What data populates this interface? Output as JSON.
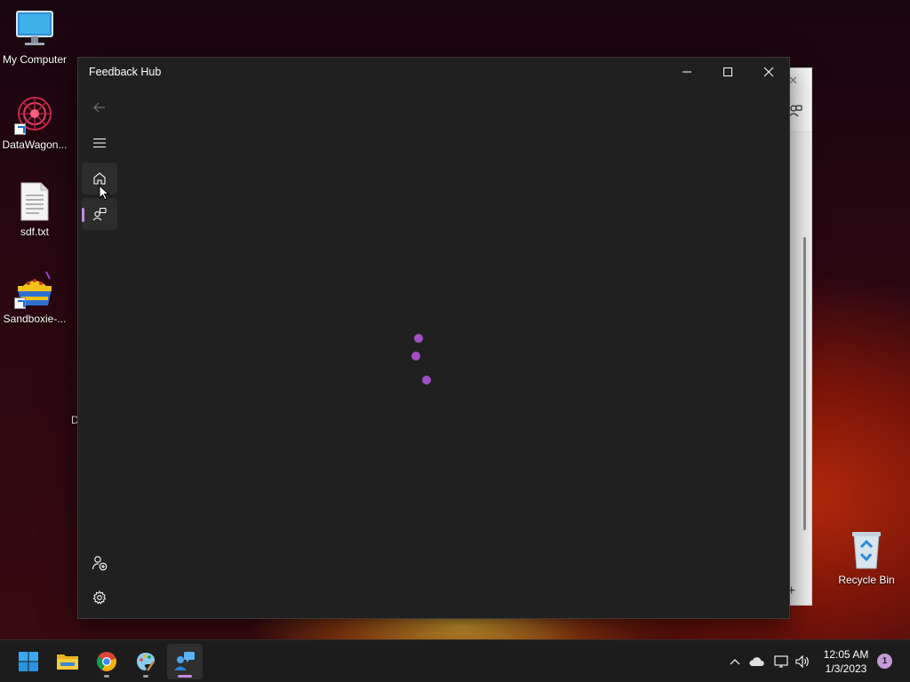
{
  "desktop": {
    "icons": [
      {
        "label": "My Computer",
        "icon": "monitor-icon"
      },
      {
        "label": "DataWagon...",
        "icon": "datawagon-icon"
      },
      {
        "label": "sdf.txt",
        "icon": "text-file-icon"
      },
      {
        "label": "Sandboxie-...",
        "icon": "sandboxie-icon"
      },
      {
        "label": "Recycle Bin",
        "icon": "recycle-bin-icon"
      }
    ],
    "stray_text": "D"
  },
  "window": {
    "title": "Feedback Hub",
    "accent": "#c28ae0",
    "loading_color": "#a14fc2",
    "nav": {
      "back": "back-arrow-icon",
      "menu": "hamburger-menu-icon",
      "home": "home-icon",
      "feedback": "feedback-icon",
      "add_account": "add-account-icon",
      "settings": "gear-icon"
    }
  },
  "taskbar": {
    "apps": [
      "start-button",
      "file-explorer",
      "chrome",
      "paint",
      "feedback-hub"
    ],
    "clock": {
      "time": "12:05 AM",
      "date": "1/3/2023"
    },
    "notification_count": "1"
  }
}
